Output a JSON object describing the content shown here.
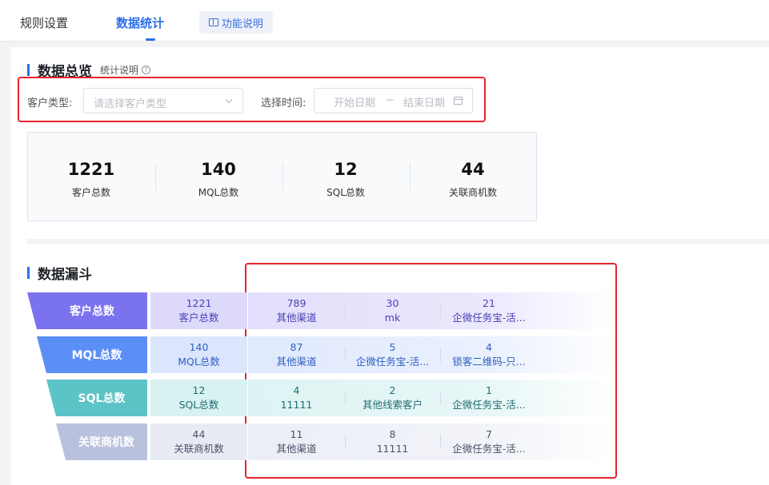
{
  "tabs": [
    {
      "label": "规则设置",
      "active": false
    },
    {
      "label": "数据统计",
      "active": true
    }
  ],
  "help_button": {
    "label": "功能说明",
    "icon": "book-icon"
  },
  "overview": {
    "title": "数据总览",
    "stat_note": "统计说明",
    "customer_type_label": "客户类型:",
    "customer_type_placeholder": "请选择客户类型",
    "time_label": "选择时间:",
    "start_date_placeholder": "开始日期",
    "range_separator": "~",
    "end_date_placeholder": "结束日期",
    "stats": [
      {
        "value": "1221",
        "label": "客户总数"
      },
      {
        "value": "140",
        "label": "MQL总数"
      },
      {
        "value": "12",
        "label": "SQL总数"
      },
      {
        "value": "44",
        "label": "关联商机数"
      }
    ]
  },
  "funnel": {
    "title": "数据漏斗",
    "colors": [
      "#7b72f0",
      "#5b8ff5",
      "#5cc3c6",
      "#b9c2dd"
    ],
    "rows": [
      {
        "stage": "客户总数",
        "total": {
          "value": "1221",
          "label": "客户总数"
        },
        "channels": [
          {
            "value": "789",
            "label": "其他渠道"
          },
          {
            "value": "30",
            "label": "mk"
          },
          {
            "value": "21",
            "label": "企微任务宝-活..."
          }
        ]
      },
      {
        "stage": "MQL总数",
        "total": {
          "value": "140",
          "label": "MQL总数"
        },
        "channels": [
          {
            "value": "87",
            "label": "其他渠道"
          },
          {
            "value": "5",
            "label": "企微任务宝-活..."
          },
          {
            "value": "4",
            "label": "锁客二维码-只..."
          }
        ]
      },
      {
        "stage": "SQL总数",
        "total": {
          "value": "12",
          "label": "SQL总数"
        },
        "channels": [
          {
            "value": "4",
            "label": "11111"
          },
          {
            "value": "2",
            "label": "其他线索客户"
          },
          {
            "value": "1",
            "label": "企微任务宝-活..."
          }
        ]
      },
      {
        "stage": "关联商机数",
        "total": {
          "value": "44",
          "label": "关联商机数"
        },
        "channels": [
          {
            "value": "11",
            "label": "其他渠道"
          },
          {
            "value": "8",
            "label": "11111"
          },
          {
            "value": "7",
            "label": "企微任务宝-活..."
          }
        ]
      }
    ]
  }
}
